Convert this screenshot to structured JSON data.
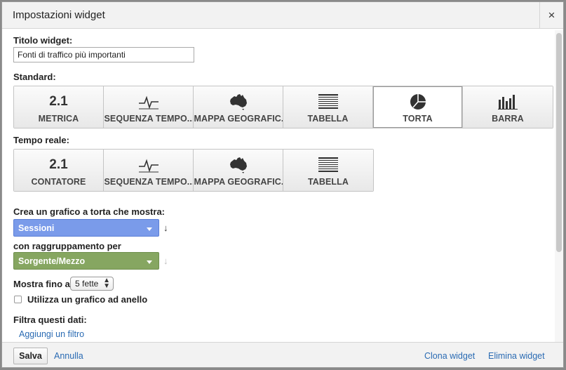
{
  "dialog": {
    "title": "Impostazioni widget",
    "close": "×"
  },
  "widget_title": {
    "label": "Titolo widget:",
    "value": "Fonti di traffico più importanti"
  },
  "standard": {
    "label": "Standard:",
    "buttons": [
      {
        "icon": "metric-icon",
        "icon_text": "2.1",
        "label": "METRICA"
      },
      {
        "icon": "timeline-icon",
        "label": "SEQUENZA TEMPO..."
      },
      {
        "icon": "geomap-icon",
        "label": "MAPPA GEOGRAFIC..."
      },
      {
        "icon": "table-icon",
        "label": "TABELLA"
      },
      {
        "icon": "pie-icon",
        "label": "TORTA",
        "selected": true
      },
      {
        "icon": "bar-icon",
        "label": "BARRA"
      }
    ]
  },
  "realtime": {
    "label": "Tempo reale:",
    "buttons": [
      {
        "icon": "counter-icon",
        "icon_text": "2.1",
        "label": "CONTATORE"
      },
      {
        "icon": "timeline-icon",
        "label": "SEQUENZA TEMPO..."
      },
      {
        "icon": "geomap-icon",
        "label": "MAPPA GEOGRAFIC..."
      },
      {
        "icon": "table-icon",
        "label": "TABELLA"
      }
    ]
  },
  "pie": {
    "label": "Crea un grafico a torta che mostra:",
    "metric_value": "Sessioni",
    "grouping_label": "con raggruppamento per",
    "grouping_value": "Sorgente/Mezzo",
    "arrow": "↓"
  },
  "show_up_to": {
    "label": "Mostra fino a",
    "value": "5 fette"
  },
  "donut": {
    "label": "Utilizza un grafico ad anello",
    "checked": false
  },
  "filter": {
    "label": "Filtra questi dati:",
    "add_link": "Aggiungi un filtro"
  },
  "footer": {
    "save": "Salva",
    "cancel": "Annulla",
    "clone": "Clona widget",
    "delete": "Elimina widget"
  },
  "colors": {
    "metric_select": "#7a9bea",
    "dimension_select": "#86a661",
    "link": "#2a6bb3"
  }
}
